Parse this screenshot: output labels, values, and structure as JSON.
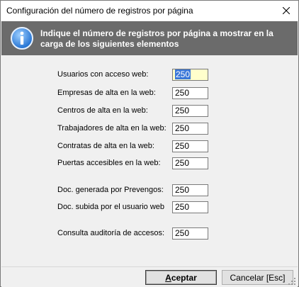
{
  "window": {
    "title": "Configuración del número de registros por página"
  },
  "banner": {
    "message": "Indique el número de registros por página a mostrar en la carga de los siguientes elementos"
  },
  "fields": [
    {
      "label": "Usuarios con acceso web:",
      "value": "250"
    },
    {
      "label": "Empresas de alta en la web:",
      "value": "250"
    },
    {
      "label": "Centros de alta en la web:",
      "value": "250"
    },
    {
      "label": "Trabajadores de alta en la web:",
      "value": "250"
    },
    {
      "label": "Contratas de alta en la web:",
      "value": "250"
    },
    {
      "label": "Puertas accesibles en la web:",
      "value": "250"
    },
    {
      "label": "Doc. generada por Prevengos:",
      "value": "250"
    },
    {
      "label": "Doc. subida por el usuario web",
      "value": "250"
    },
    {
      "label": "Consulta auditoría de accesos:",
      "value": "250"
    }
  ],
  "buttons": {
    "accept_label": "Aceptar",
    "accept_underline": "A",
    "accept_rest": "ceptar",
    "cancel_label": "Cancelar  [Esc]"
  },
  "colors": {
    "banner": "#6b6b6b",
    "focused_field": "#ffffcc",
    "selection": "#3a78d8"
  },
  "icons": {
    "banner": "info-icon",
    "close": "close-icon"
  }
}
